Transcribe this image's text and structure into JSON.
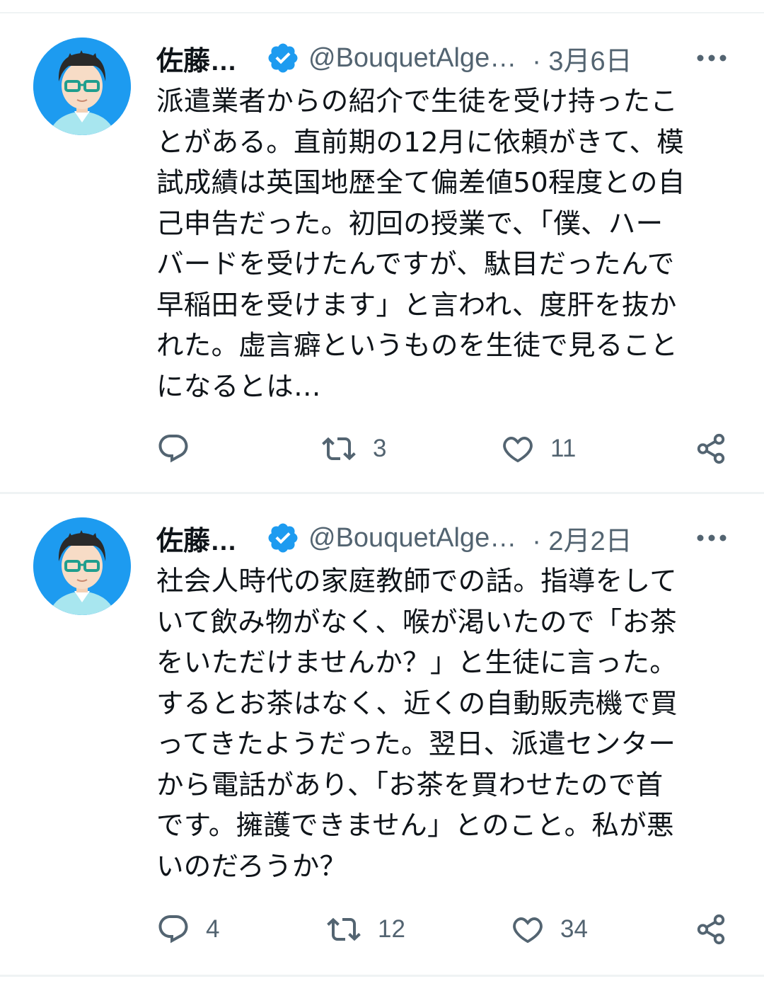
{
  "tweets": [
    {
      "author_name": "佐藤…",
      "handle": "@BouquetAlge…",
      "date": "· 3月6日",
      "lines": [
        "派遣業者からの紹介で生徒を受け持ったこ",
        "とがある。直前期の12月に依頼がきて、模",
        "試成績は英国地歴全て偏差値50程度との自",
        "己申告だった。初回の授業で、「僕、ハー",
        "バードを受けたんですが、駄目だったんで",
        "早稲田を受けます」と言われ、度肝を抜か",
        "れた。虚言癖というものを生徒で見ること",
        "になるとは…"
      ],
      "replies": "",
      "retweets": "3",
      "likes": "11"
    },
    {
      "author_name": "佐藤…",
      "handle": "@BouquetAlge…",
      "date": "· 2月2日",
      "lines": [
        "社会人時代の家庭教師での話。指導をして",
        "いて飲み物がなく、喉が渇いたので「お茶",
        "をいただけませんか？」と生徒に言った。",
        "するとお茶はなく、近くの自動販売機で買",
        "ってきたようだった。翌日、派遣センター",
        "から電話があり、「お茶を買わせたので首",
        "です。擁護できません」とのこと。私が悪",
        "いのだろうか？"
      ],
      "replies": "4",
      "retweets": "12",
      "likes": "34"
    }
  ],
  "icons": {
    "verified": "verified-badge-icon",
    "more": "more-icon",
    "reply": "reply-icon",
    "retweet": "retweet-icon",
    "like": "like-icon",
    "share": "share-icon"
  },
  "colors": {
    "verified": "#1d9bf0",
    "secondary_text": "#536471",
    "divider": "#eff3f4",
    "avatar_bg": "#1d9bf0"
  }
}
